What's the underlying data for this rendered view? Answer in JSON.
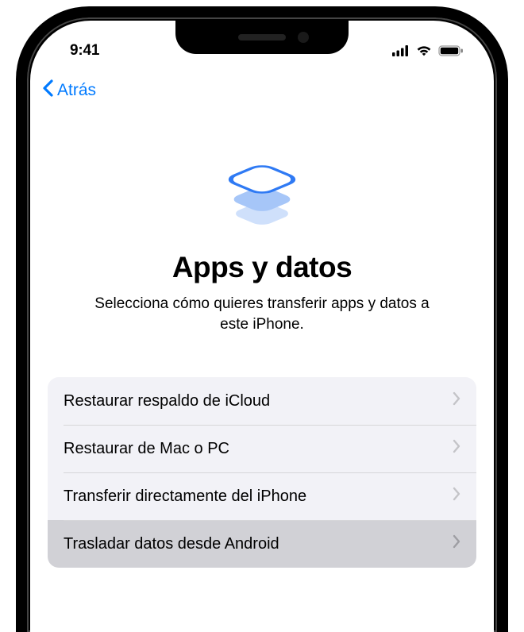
{
  "status": {
    "time": "9:41"
  },
  "nav": {
    "back_label": "Atrás"
  },
  "page": {
    "title": "Apps y datos",
    "subtitle": "Selecciona cómo quieres transferir apps y datos a este iPhone."
  },
  "options": [
    {
      "label": "Restaurar respaldo de iCloud",
      "selected": false
    },
    {
      "label": "Restaurar de Mac o PC",
      "selected": false
    },
    {
      "label": "Transferir directamente del iPhone",
      "selected": false
    },
    {
      "label": "Trasladar datos desde Android",
      "selected": true
    }
  ]
}
